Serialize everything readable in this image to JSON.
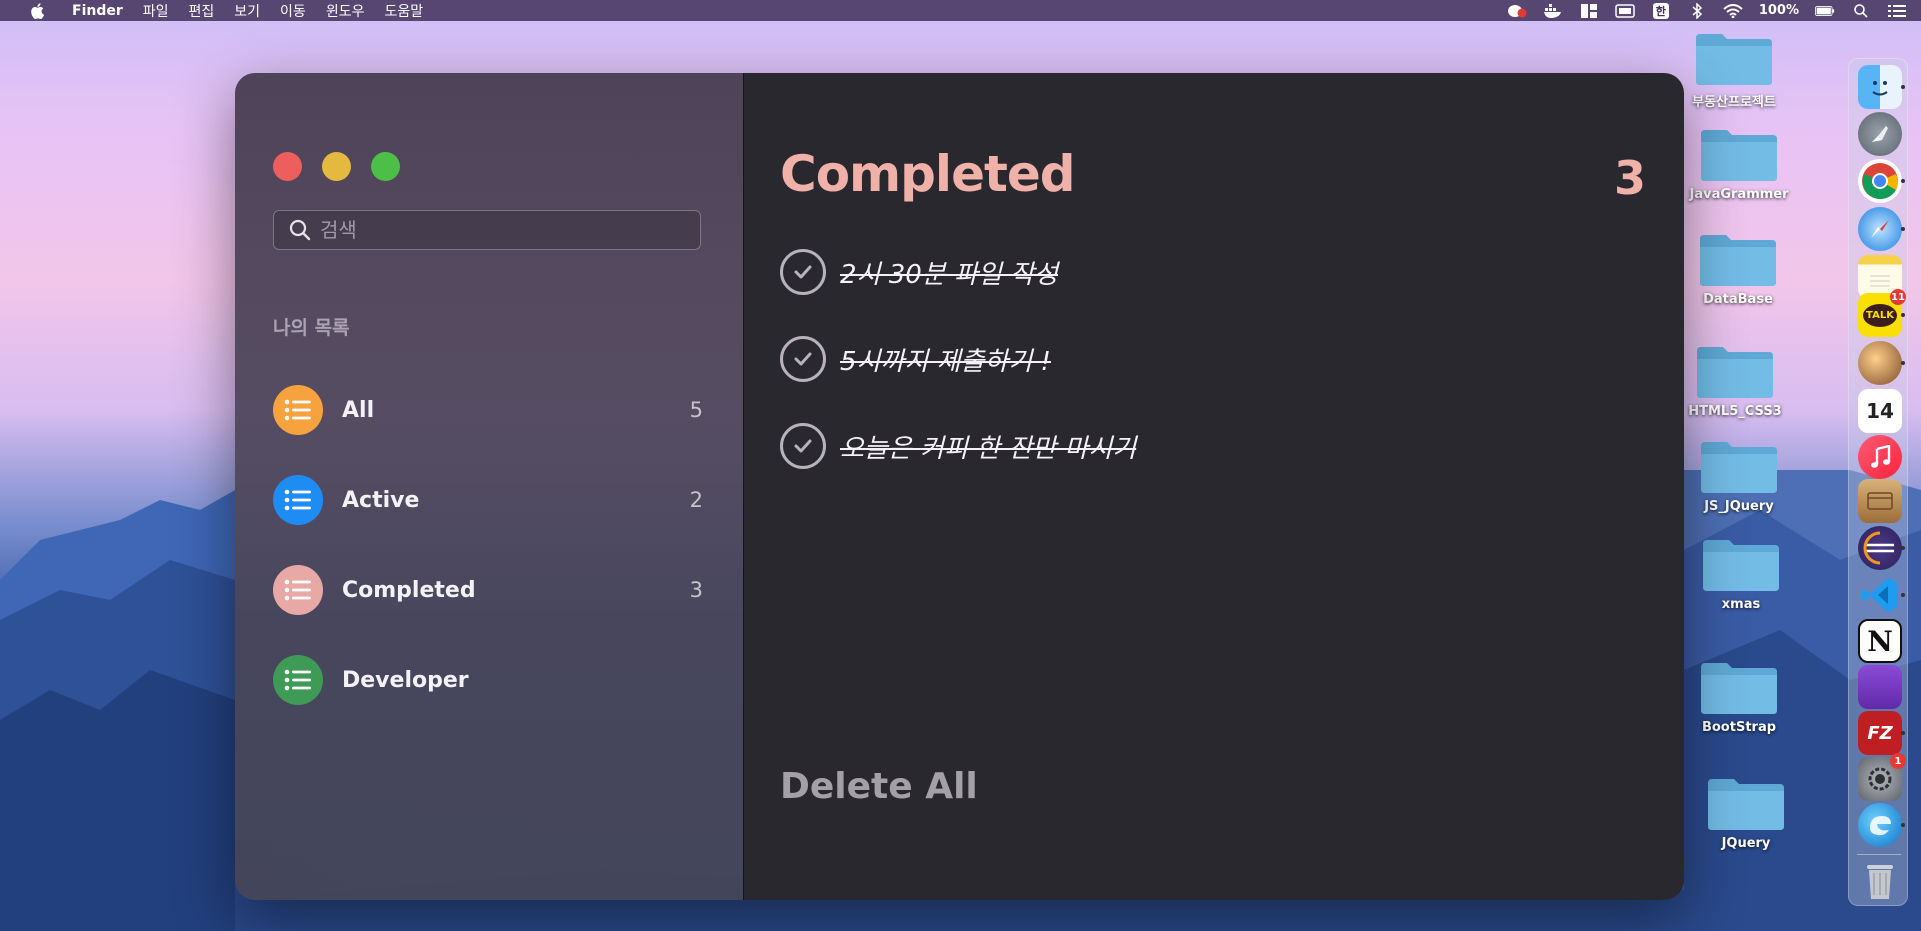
{
  "menubar": {
    "app": "Finder",
    "menus": [
      "파일",
      "편집",
      "보기",
      "이동",
      "윈도우",
      "도움말"
    ],
    "input_source": "한",
    "battery": "100%"
  },
  "window": {
    "search": {
      "placeholder": "검색",
      "value": ""
    },
    "section_title": "나의 목록",
    "lists": [
      {
        "label": "All",
        "count": "5",
        "color": "#f6a23e",
        "icon": "list-icon"
      },
      {
        "label": "Active",
        "count": "2",
        "color": "#1f8cf3",
        "icon": "list-icon"
      },
      {
        "label": "Completed",
        "count": "3",
        "color": "#e8a8a6",
        "icon": "list-icon"
      },
      {
        "label": "Developer",
        "count": "",
        "color": "#3f9a56",
        "icon": "list-icon"
      }
    ],
    "main": {
      "title": "Completed",
      "count": "3",
      "todos": [
        {
          "text": "2시 30분 파일 작성",
          "completed": true
        },
        {
          "text": "5시까지 제출하기 !",
          "completed": true
        },
        {
          "text": "오늘은 커피 한 잔만 마시기",
          "completed": true
        }
      ],
      "delete_all": "Delete All"
    },
    "accent_color": "#f0b1a9"
  },
  "desktop": {
    "folders": [
      "부동산프로젝트",
      "JavaGrammer",
      "DataBase",
      "HTML5_CSS3",
      "JS_JQuery",
      "xmas",
      "BootStrap",
      "JQuery"
    ]
  },
  "dock": {
    "apps": [
      {
        "name": "finder-icon"
      },
      {
        "name": "launchpad-icon"
      },
      {
        "name": "chrome-icon"
      },
      {
        "name": "safari-icon"
      },
      {
        "name": "notes-icon"
      },
      {
        "name": "kakaotalk-icon",
        "label": "TALK",
        "badge": "11"
      },
      {
        "name": "photo-app-icon"
      },
      {
        "name": "calendar-icon",
        "label": "14"
      },
      {
        "name": "music-icon"
      },
      {
        "name": "archive-utility-icon"
      },
      {
        "name": "eclipse-icon"
      },
      {
        "name": "vscode-icon"
      },
      {
        "name": "notion-icon",
        "label": "N"
      },
      {
        "name": "purple-app-icon"
      },
      {
        "name": "filezilla-icon",
        "label": "FZ"
      },
      {
        "name": "system-preferences-icon",
        "badge": "1"
      },
      {
        "name": "edge-icon"
      },
      {
        "name": "trash-icon"
      }
    ]
  }
}
